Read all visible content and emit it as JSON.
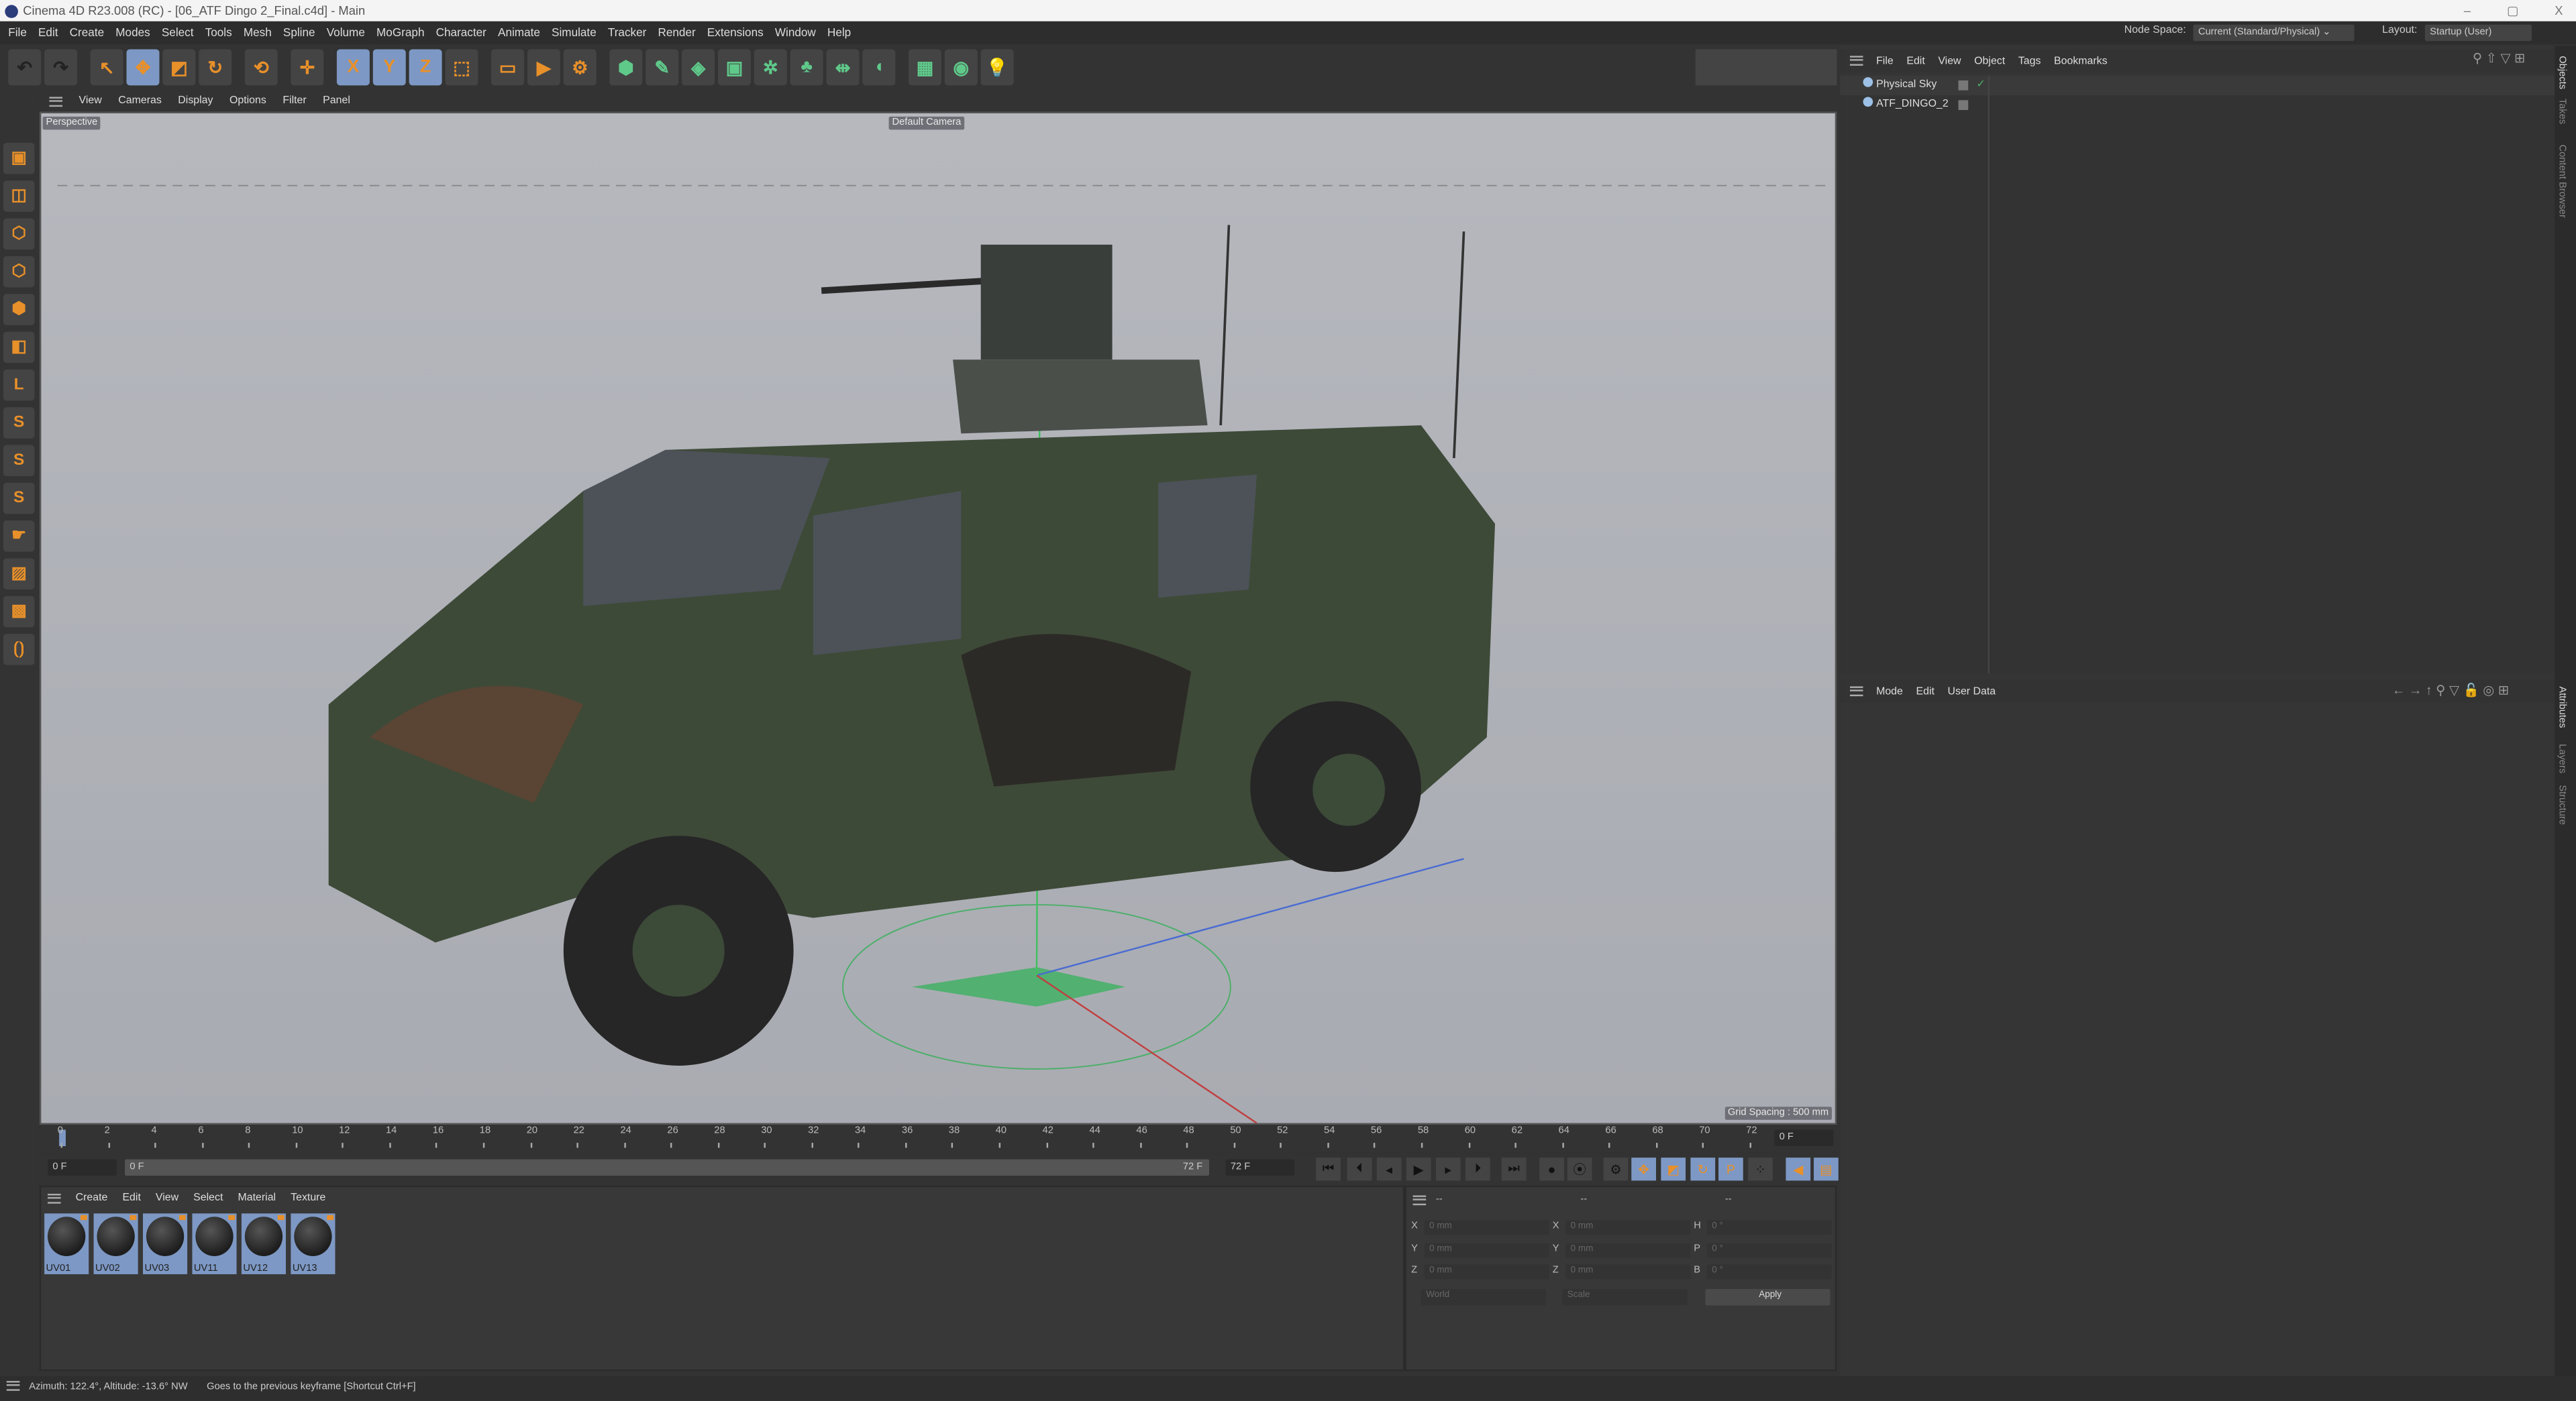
{
  "window": {
    "title": "Cinema 4D R23.008 (RC) - [06_ATF Dingo 2_Final.c4d] - Main",
    "controls": [
      "–",
      "▢",
      "X"
    ]
  },
  "menu": [
    "File",
    "Edit",
    "Create",
    "Modes",
    "Select",
    "Tools",
    "Mesh",
    "Spline",
    "Volume",
    "MoGraph",
    "Character",
    "Animate",
    "Simulate",
    "Tracker",
    "Render",
    "Extensions",
    "Window",
    "Help"
  ],
  "header": {
    "node_space_label": "Node Space:",
    "node_space_value": "Current (Standard/Physical)",
    "layout_label": "Layout:",
    "layout_value": "Startup (User)"
  },
  "toolbar": [
    {
      "icon": "undo-icon",
      "glyph": "↶"
    },
    {
      "icon": "redo-icon",
      "glyph": "↷"
    },
    {
      "icon": "select-icon",
      "glyph": "↖"
    },
    {
      "icon": "move-icon",
      "glyph": "✥",
      "sel": true
    },
    {
      "icon": "scale-icon",
      "glyph": "◩"
    },
    {
      "icon": "rotate-icon",
      "glyph": "↻"
    },
    {
      "icon": "psr-icon",
      "glyph": "⟲"
    },
    {
      "icon": "add-icon",
      "glyph": "✛"
    },
    {
      "icon": "x-axis-icon",
      "glyph": "X",
      "sel": true
    },
    {
      "icon": "y-axis-icon",
      "glyph": "Y",
      "sel": true
    },
    {
      "icon": "z-axis-icon",
      "glyph": "Z",
      "sel": true
    },
    {
      "icon": "coord-system-icon",
      "glyph": "⬚"
    },
    {
      "icon": "render-region-icon",
      "glyph": "▭"
    },
    {
      "icon": "render-view-icon",
      "glyph": "▶"
    },
    {
      "icon": "render-settings-icon",
      "glyph": "⚙"
    },
    {
      "icon": "cube-icon",
      "glyph": "⬢"
    },
    {
      "icon": "pen-icon",
      "glyph": "✎"
    },
    {
      "icon": "subdivision-icon",
      "glyph": "◈"
    },
    {
      "icon": "extrude-icon",
      "glyph": "▣"
    },
    {
      "icon": "cloner-icon",
      "glyph": "✲"
    },
    {
      "icon": "mograph-icon",
      "glyph": "♣"
    },
    {
      "icon": "deformer-icon",
      "glyph": "⇹"
    },
    {
      "icon": "field-icon",
      "glyph": "◖"
    },
    {
      "icon": "floor-icon",
      "glyph": "▦"
    },
    {
      "icon": "camera-icon",
      "glyph": "◉"
    },
    {
      "icon": "light-icon",
      "glyph": "💡"
    }
  ],
  "left_tools": [
    {
      "icon": "model-mode-icon",
      "glyph": "▣"
    },
    {
      "icon": "texture-mode-icon",
      "glyph": "◫"
    },
    {
      "icon": "points-mode-icon",
      "glyph": "⬡"
    },
    {
      "icon": "edges-mode-icon",
      "glyph": "⬡"
    },
    {
      "icon": "polygons-mode-icon",
      "glyph": "⬢"
    },
    {
      "icon": "uv-mode-icon",
      "glyph": "◧"
    },
    {
      "icon": "axis-icon",
      "glyph": "L"
    },
    {
      "icon": "snap-icon",
      "glyph": "S"
    },
    {
      "icon": "snap-settings-icon",
      "glyph": "S"
    },
    {
      "icon": "snap-workplane-icon",
      "glyph": "S"
    },
    {
      "icon": "tweak-icon",
      "glyph": "☛"
    },
    {
      "icon": "workplane-icon",
      "glyph": "▨"
    },
    {
      "icon": "grid-icon",
      "glyph": "▩"
    },
    {
      "icon": "locked-workplane-icon",
      "glyph": "⟮⟯"
    }
  ],
  "viewport": {
    "menu": [
      "View",
      "Cameras",
      "Display",
      "Options",
      "Filter",
      "Panel"
    ],
    "projection": "Perspective",
    "camera": "Default Camera",
    "grid_spacing": "Grid Spacing : 500 mm"
  },
  "timeline": {
    "ticks": [
      0,
      2,
      4,
      6,
      8,
      10,
      12,
      14,
      16,
      18,
      20,
      22,
      24,
      26,
      28,
      30,
      32,
      34,
      36,
      38,
      40,
      42,
      44,
      46,
      48,
      50,
      52,
      54,
      56,
      58,
      60,
      62,
      64,
      66,
      68,
      70,
      72
    ],
    "current_frame": "0 F",
    "start_field": "0 F",
    "range_start": "0 F",
    "range_end": "72 F",
    "end_field": "72 F"
  },
  "materials": {
    "menu": [
      "Create",
      "Edit",
      "View",
      "Select",
      "Material",
      "Texture"
    ],
    "items": [
      "UV01",
      "UV02",
      "UV03",
      "UV11",
      "UV12",
      "UV13"
    ]
  },
  "coordinates": {
    "headers": [
      "--",
      "--",
      "--"
    ],
    "rows": [
      {
        "a": "X",
        "av": "0 mm",
        "b": "X",
        "bv": "0 mm",
        "c": "H",
        "cv": "0 °"
      },
      {
        "a": "Y",
        "av": "0 mm",
        "b": "Y",
        "bv": "0 mm",
        "c": "P",
        "cv": "0 °"
      },
      {
        "a": "Z",
        "av": "0 mm",
        "b": "Z",
        "bv": "0 mm",
        "c": "B",
        "cv": "0 °"
      }
    ],
    "mode": "World",
    "transform": "Scale",
    "apply": "Apply"
  },
  "objects": {
    "menu": [
      "File",
      "Edit",
      "View",
      "Object",
      "Tags",
      "Bookmarks"
    ],
    "items": [
      "Physical Sky",
      "ATF_DINGO_2"
    ]
  },
  "attributes": {
    "menu": [
      "Mode",
      "Edit",
      "User Data"
    ]
  },
  "side_tabs_top": [
    "Objects",
    "Takes",
    "Content Browser"
  ],
  "side_tabs_bottom": [
    "Attributes",
    "Layers",
    "Structure"
  ],
  "status": {
    "left": "Azimuth: 122.4°, Altitude: -13.6°  NW",
    "message": "Goes to the previous keyframe [Shortcut Ctrl+F]"
  },
  "colors": {
    "accent": "#7d98c4",
    "orange": "#e8902a",
    "bg": "#333333"
  }
}
